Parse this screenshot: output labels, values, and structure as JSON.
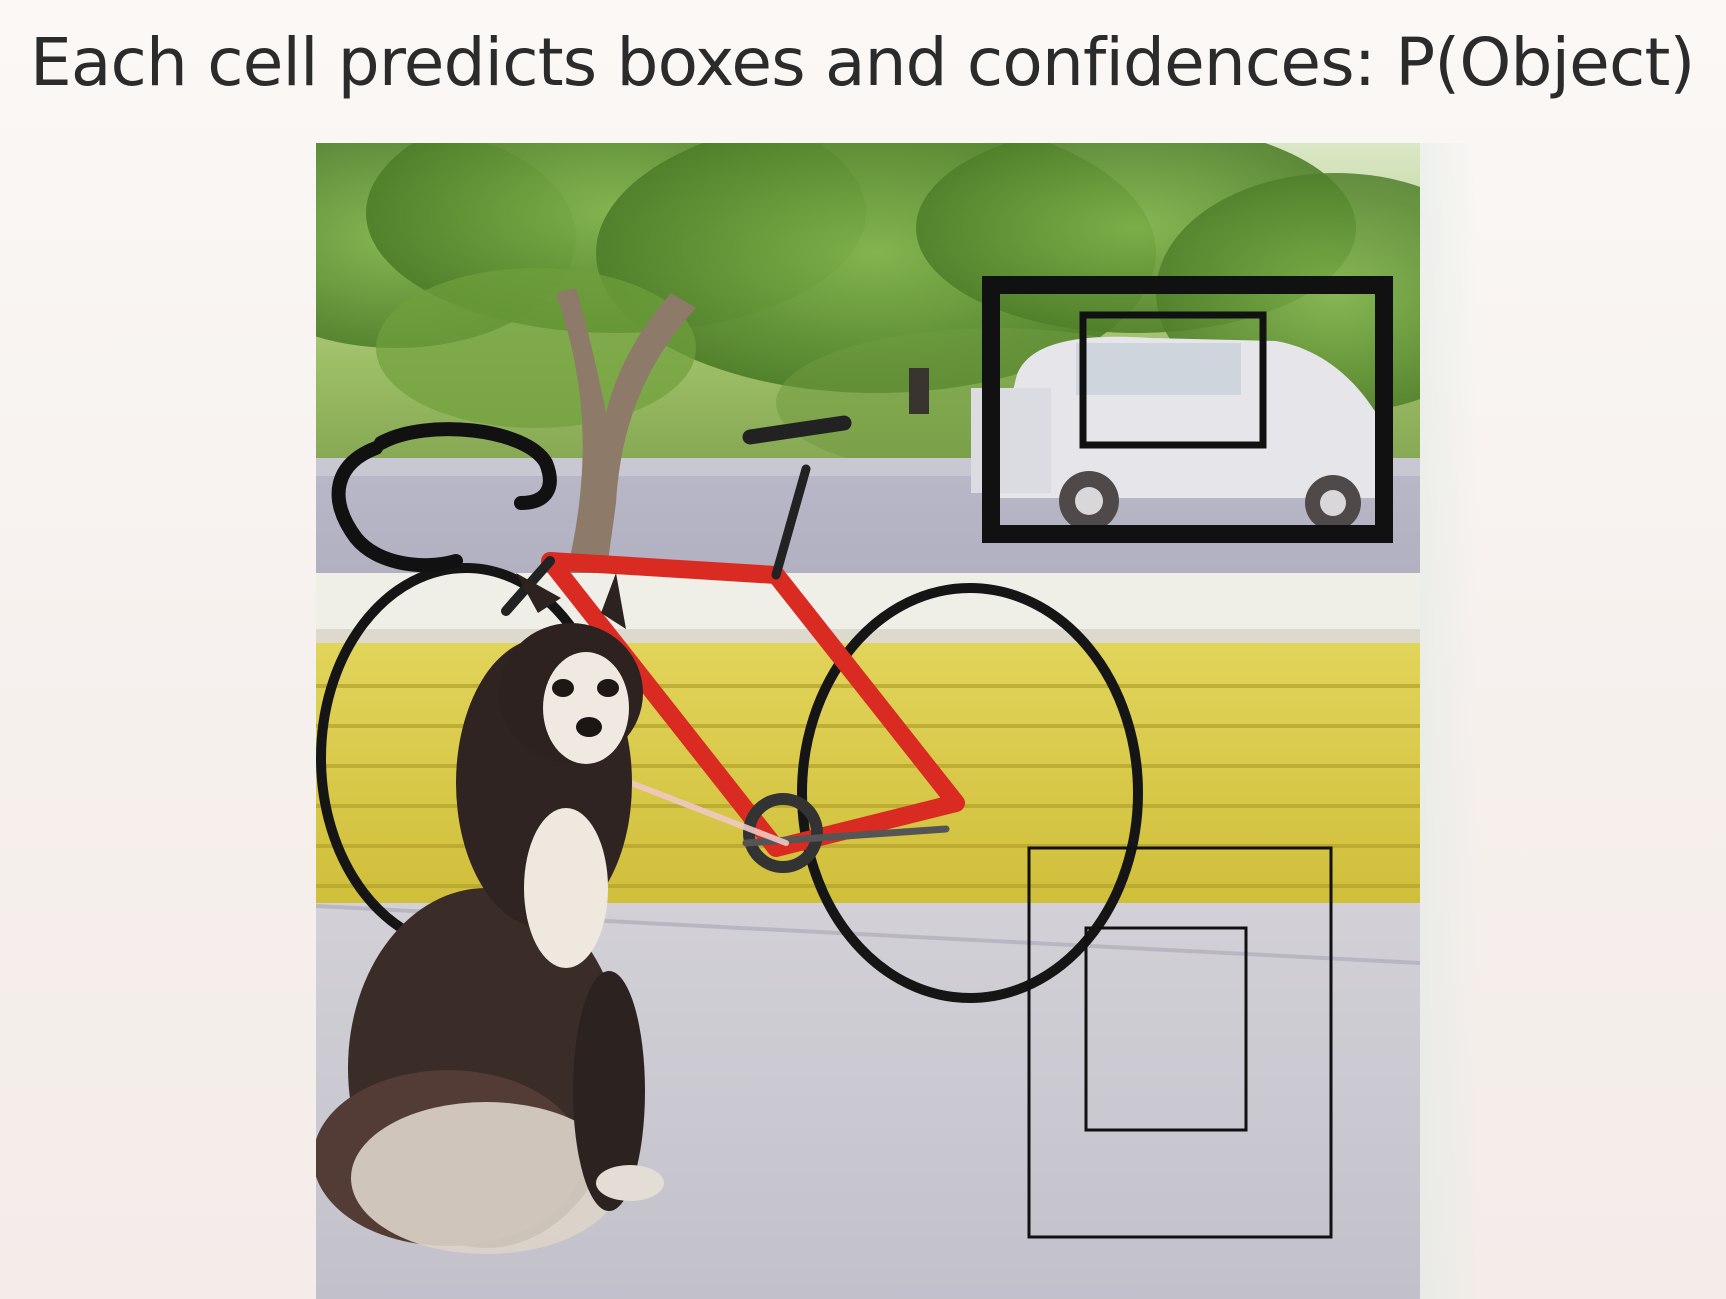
{
  "slide": {
    "title": "Each cell predicts boxes and confidences: P(Object)"
  },
  "image": {
    "subject_icon": "photo-scene-icon"
  },
  "colors": {
    "background": "#f7f2ef",
    "title_text": "#2b2b2b",
    "bounding_box_stroke": "#111111",
    "bike_frame": "#d92b22",
    "wall": "#d8c742",
    "floor": "#c9c7cf"
  }
}
